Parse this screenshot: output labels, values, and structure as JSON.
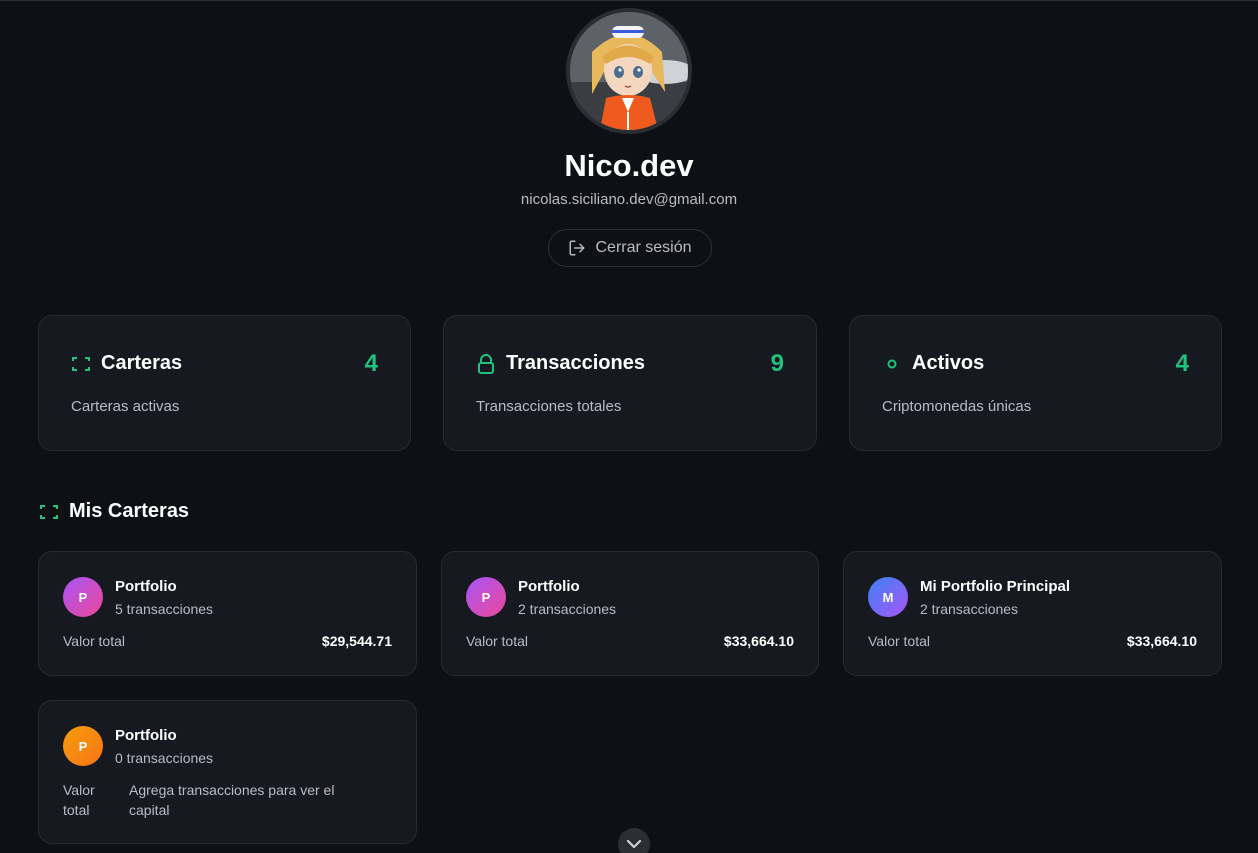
{
  "profile": {
    "name": "Nico.dev",
    "email": "nicolas.siciliano.dev@gmail.com",
    "avatar_icon": "anime-avatar-image",
    "logout_label": "Cerrar sesión"
  },
  "stats": [
    {
      "icon": "wallet-icon",
      "title": "Carteras",
      "value": "4",
      "description": "Carteras activas"
    },
    {
      "icon": "lock-icon",
      "title": "Transacciones",
      "value": "9",
      "description": "Transacciones totales"
    },
    {
      "icon": "coin-icon",
      "title": "Activos",
      "value": "4",
      "description": "Criptomonedas únicas"
    }
  ],
  "wallets_section": {
    "title": "Mis Carteras",
    "icon": "wallet-icon"
  },
  "wallets": [
    {
      "initial": "P",
      "name": "Portfolio",
      "transactions": "5 transacciones",
      "value_label": "Valor total",
      "value": "$29,544.71"
    },
    {
      "initial": "P",
      "name": "Portfolio",
      "transactions": "2 transacciones",
      "value_label": "Valor total",
      "value": "$33,664.10"
    },
    {
      "initial": "M",
      "name": "Mi Portfolio Principal",
      "transactions": "2 transacciones",
      "value_label": "Valor total",
      "value": "$33,664.10"
    },
    {
      "initial": "P",
      "name": "Portfolio",
      "transactions": "0 transacciones",
      "value_label": "Valor total",
      "empty_message": "Agrega transacciones para ver el capital"
    }
  ],
  "colors": {
    "background": "#0d1015",
    "card": "#161a20",
    "accent": "#22c17e",
    "muted_text": "#b7bcc4"
  },
  "scroll_icon": "chevron-down-icon"
}
